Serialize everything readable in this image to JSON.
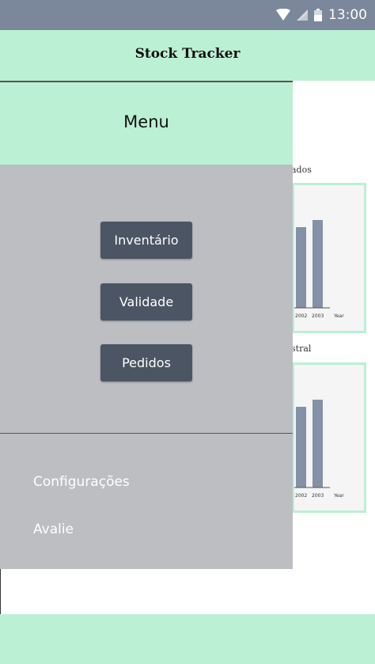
{
  "status_bar": {
    "time": "13:00",
    "icons": [
      "wifi-icon",
      "signal-icon",
      "battery-icon"
    ]
  },
  "app_bar": {
    "title": "Stock Tracker"
  },
  "background_charts": [
    {
      "visible_label": "ados"
    },
    {
      "visible_label": "stral"
    }
  ],
  "chart_data": [
    {
      "type": "bar",
      "categories": [
        "2002",
        "2003"
      ],
      "values": [
        null,
        null
      ],
      "xlabel": "Year",
      "visible_tick_labels": [
        "2002",
        "2003",
        "Year"
      ]
    },
    {
      "type": "bar",
      "categories": [
        "2002",
        "2003"
      ],
      "values": [
        null,
        null
      ],
      "xlabel": "Year",
      "visible_tick_labels": [
        "2002",
        "2003",
        "Year"
      ]
    }
  ],
  "drawer": {
    "title": "Menu",
    "buttons": [
      {
        "label": "Inventário"
      },
      {
        "label": "Validade"
      },
      {
        "label": "Pedidos"
      }
    ],
    "links": [
      {
        "label": "Configurações"
      },
      {
        "label": "Avalie"
      }
    ]
  },
  "colors": {
    "accent": "#bbf0d4",
    "status_bar": "#7b879b",
    "drawer_bg": "#bcbec2",
    "button_bg": "#4b5563",
    "bar_color": "#8591a6"
  }
}
